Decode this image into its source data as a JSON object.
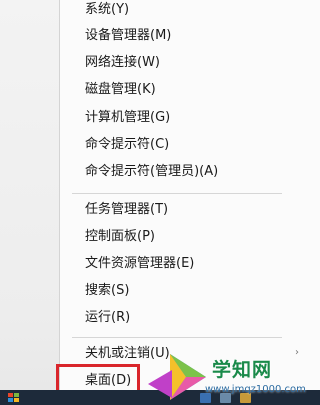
{
  "context_menu": {
    "items": [
      {
        "label": "系统(Y)"
      },
      {
        "label": "设备管理器(M)"
      },
      {
        "label": "网络连接(W)"
      },
      {
        "label": "磁盘管理(K)"
      },
      {
        "label": "计算机管理(G)"
      },
      {
        "label": "命令提示符(C)"
      },
      {
        "label": "命令提示符(管理员)(A)"
      },
      {
        "label": "任务管理器(T)"
      },
      {
        "label": "控制面板(P)"
      },
      {
        "label": "文件资源管理器(E)"
      },
      {
        "label": "搜索(S)"
      },
      {
        "label": "运行(R)"
      },
      {
        "label": "关机或注销(U)"
      },
      {
        "label": "桌面(D)"
      }
    ],
    "submenu_glyph": "›",
    "highlight_color": "#d9252b"
  },
  "watermark": {
    "title": "学知网",
    "url": "www.jmqz1000.com"
  },
  "taskbar": {
    "color": "#1d2a3a"
  }
}
